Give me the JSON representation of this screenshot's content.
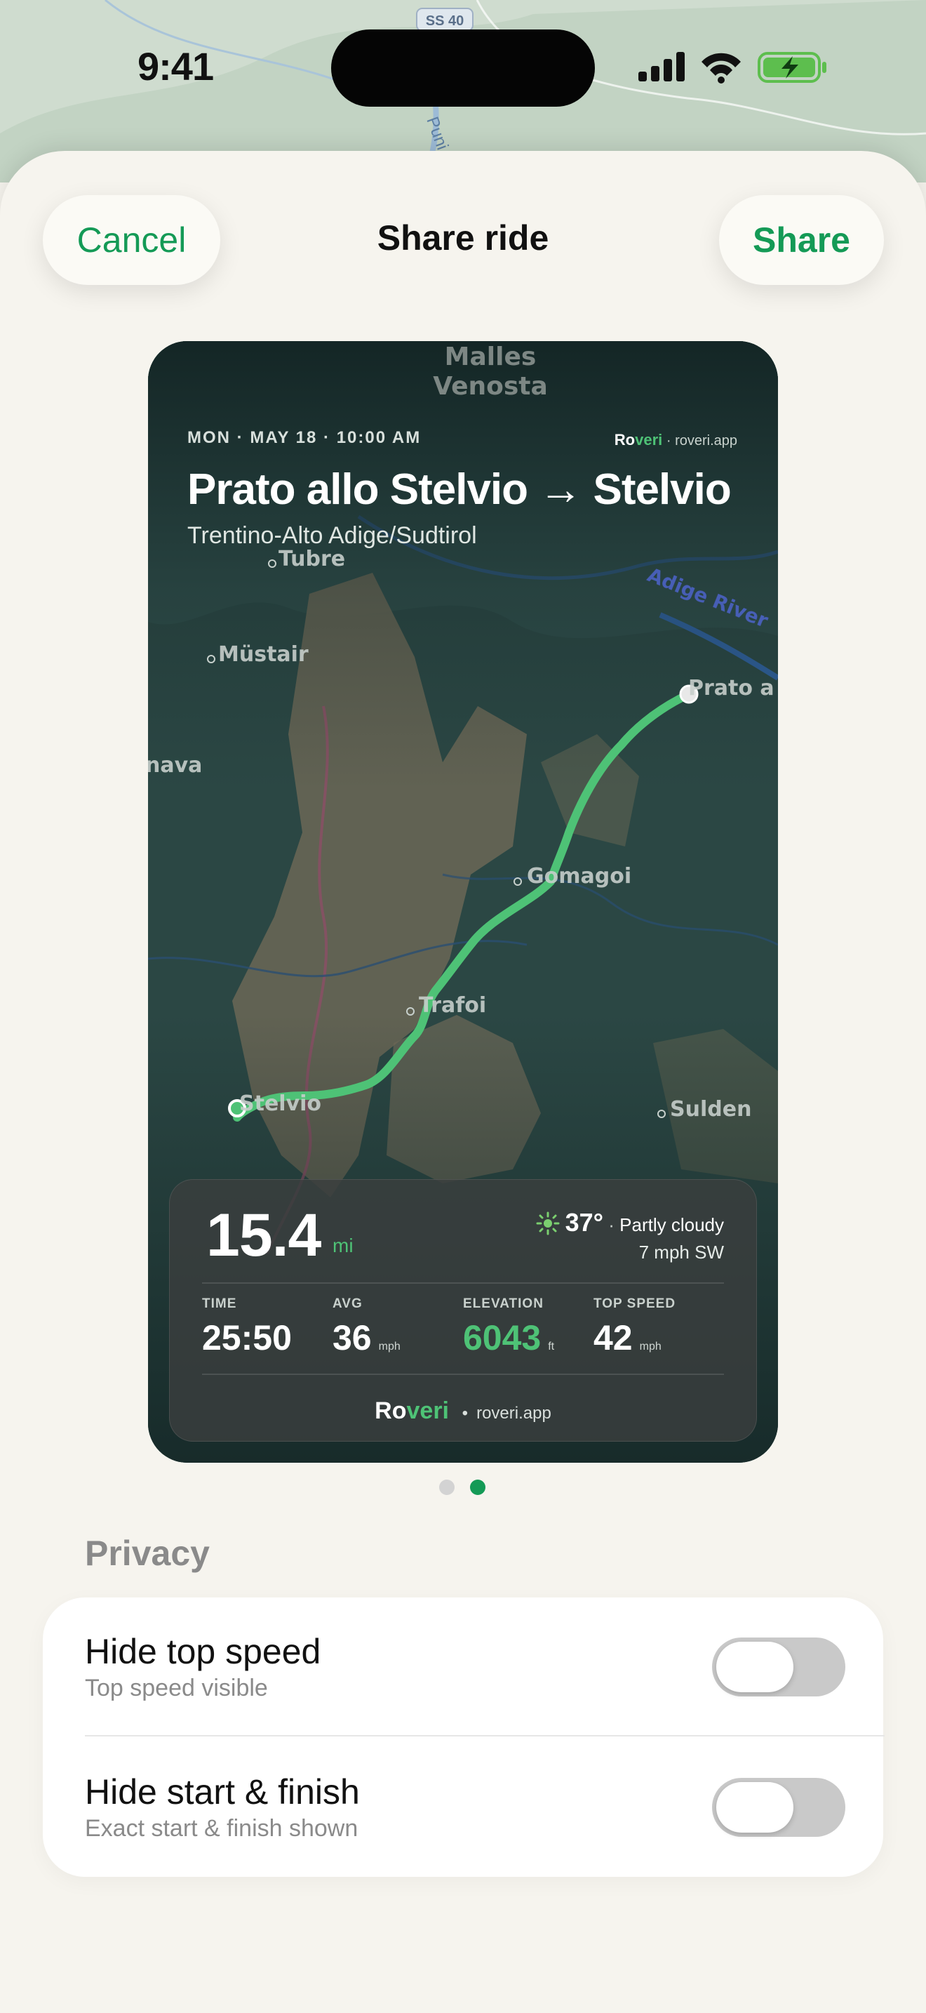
{
  "status_bar": {
    "time": "9:41"
  },
  "background_map": {
    "road_badge": "SS 40",
    "water_label": "Puni"
  },
  "sheet": {
    "cancel_label": "Cancel",
    "title": "Share ride",
    "share_label": "Share"
  },
  "card": {
    "date_line": "MON · MAY 18 · 10:00 AM",
    "brand_small": "Roveri",
    "brand_domain_small": "roveri.app",
    "title": "Prato allo Stelvio → Stelvio",
    "subtitle": "Trentino-Alto Adige/Sudtirol",
    "map_labels": {
      "malles_line1": "Malles",
      "malles_line2": "Venosta",
      "tubre": "Tubre",
      "mustair": "Müstair",
      "nava": "nava",
      "river": "Adige River",
      "prato": "Prato a",
      "gomagoi": "Gomagoi",
      "trafoi": "Trafoi",
      "stelvio": "Stelvio",
      "sulden": "Sulden"
    },
    "stats": {
      "distance": "15.4",
      "distance_unit": "mi",
      "temperature": "37°",
      "conditions": "Partly cloudy",
      "wind": "7 mph SW",
      "time_label": "TIME",
      "time_value": "25:50",
      "avg_label": "AVG",
      "avg_value": "36",
      "avg_unit": "mph",
      "elev_label": "ELEVATION",
      "elev_value": "6043",
      "elev_unit": "ft",
      "top_label": "TOP SPEED",
      "top_value": "42",
      "top_unit": "mph"
    },
    "footer_brand_ro": "Ro",
    "footer_brand_veri": "veri",
    "footer_domain": "roveri.app"
  },
  "pager": {
    "pages": 2,
    "active": 2
  },
  "privacy": {
    "heading": "Privacy",
    "rows": [
      {
        "title": "Hide top speed",
        "subtitle": "Top speed visible",
        "on": false
      },
      {
        "title": "Hide start & finish",
        "subtitle": "Exact start & finish shown",
        "on": false
      }
    ]
  },
  "colors": {
    "accent": "#149a56",
    "route": "#4ec276"
  }
}
